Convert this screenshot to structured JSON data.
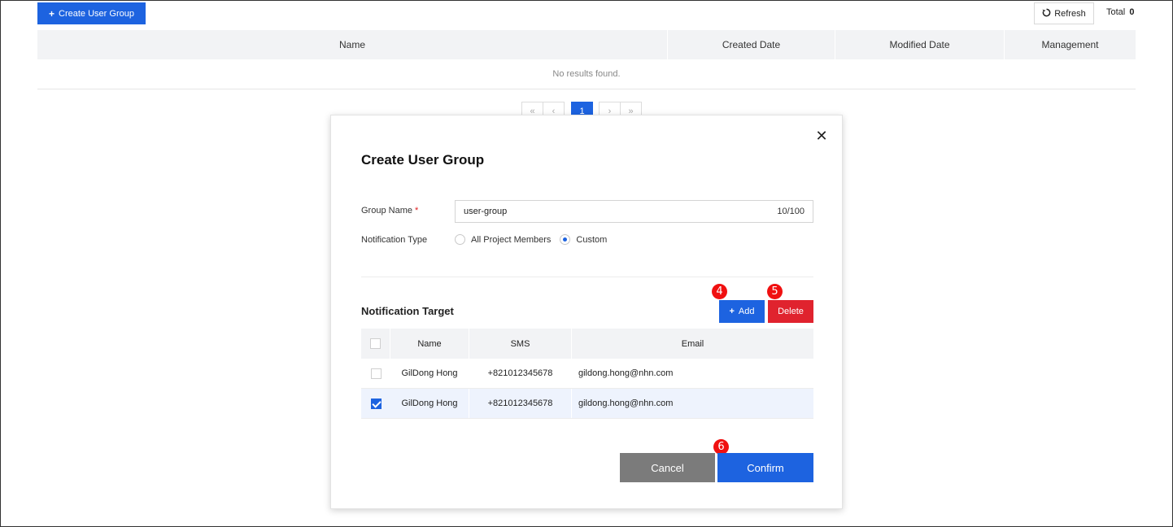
{
  "toolbar": {
    "create_label": "Create User Group",
    "refresh_label": "Refresh",
    "total_label": "Total",
    "total_value": "0"
  },
  "main_table": {
    "columns": [
      "Name",
      "Created Date",
      "Modified Date",
      "Management"
    ],
    "empty_text": "No results found."
  },
  "pagination": {
    "first": "«",
    "prev": "‹",
    "current": "1",
    "next": "›",
    "last": "»"
  },
  "dialog": {
    "title": "Create User Group",
    "close_glyph": "✕",
    "group_name_label": "Group Name",
    "required_mark": "*",
    "group_name_value": "user-group",
    "group_name_counter": "10/100",
    "notification_type_label": "Notification Type",
    "notification_options": [
      {
        "label": "All Project Members",
        "selected": false
      },
      {
        "label": "Custom",
        "selected": true
      }
    ],
    "target_title": "Notification Target",
    "add_label": "Add",
    "delete_label": "Delete",
    "target_columns": [
      "Name",
      "SMS",
      "Email"
    ],
    "target_rows": [
      {
        "name": "GilDong Hong",
        "sms": "+821012345678",
        "email": "gildong.hong@nhn.com",
        "checked": false
      },
      {
        "name": "GilDong Hong",
        "sms": "+821012345678",
        "email": "gildong.hong@nhn.com",
        "checked": true
      }
    ],
    "cancel_label": "Cancel",
    "confirm_label": "Confirm"
  },
  "markers": {
    "add": "4",
    "delete": "5",
    "confirm": "6"
  },
  "colors": {
    "primary": "#1d63e0",
    "danger": "#e0232e",
    "cancel": "#7b7b7b",
    "marker": "#f01010"
  }
}
